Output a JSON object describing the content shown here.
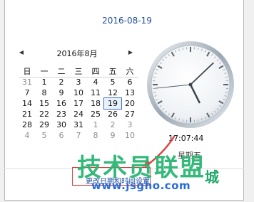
{
  "header": {
    "selected_date": "2016-08-19"
  },
  "calendar": {
    "month_title": "2016年8月",
    "weekdays": [
      "日",
      "一",
      "二",
      "三",
      "四",
      "五",
      "六"
    ],
    "rows": [
      [
        "31",
        "1",
        "2",
        "3",
        "4",
        "5",
        "6"
      ],
      [
        "7",
        "8",
        "9",
        "10",
        "11",
        "12",
        "13"
      ],
      [
        "14",
        "15",
        "16",
        "17",
        "18",
        "19",
        "20"
      ],
      [
        "21",
        "22",
        "23",
        "24",
        "25",
        "26",
        "27"
      ],
      [
        "28",
        "29",
        "30",
        "31",
        "1",
        "2",
        "3"
      ],
      [
        "4",
        "5",
        "6",
        "7",
        "8",
        "9",
        "10"
      ]
    ],
    "prev_icon": "triangle-left",
    "next_icon": "triangle-right"
  },
  "clock": {
    "time": "17:07:44",
    "weekday": "星期五"
  },
  "footer": {
    "change_link": "更改日期和时间设置..."
  },
  "watermark": {
    "brand": "技术员联盟",
    "url": "www.jsgho.com",
    "tag": "城"
  },
  "colors": {
    "accent": "#1f4e9c",
    "highlight": "#e8f0fc",
    "watermark_green": "#2bb673",
    "watermark_blue": "#2a6bd8",
    "arrow_red": "#d44"
  }
}
